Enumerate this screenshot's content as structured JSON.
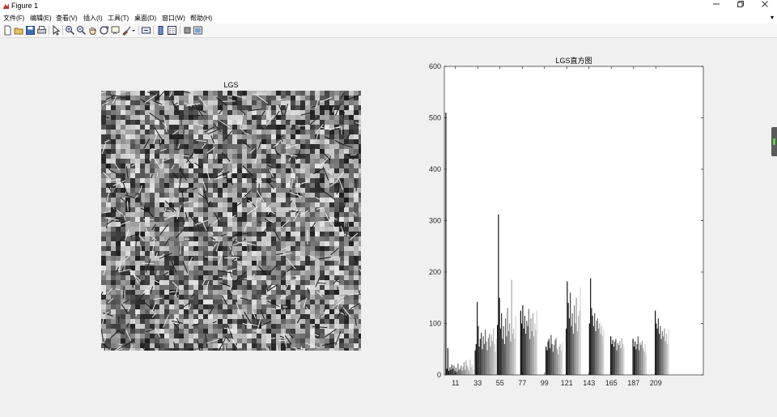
{
  "window": {
    "title": "Figure 1",
    "minimize_icon": "minimize-icon",
    "restore_icon": "restore-icon",
    "close_icon": "close-icon"
  },
  "menu": {
    "items": [
      "文件(F)",
      "编辑(E)",
      "查看(V)",
      "插入(I)",
      "工具(T)",
      "桌面(D)",
      "窗口(W)",
      "帮助(H)"
    ],
    "overflow_glyph": "▾"
  },
  "toolbar": {
    "icons": [
      "new-figure-icon",
      "open-file-icon",
      "save-icon",
      "print-icon",
      "edit-plot-arrow-icon",
      "zoom-in-icon",
      "zoom-out-icon",
      "pan-hand-icon",
      "rotate-3d-icon",
      "data-cursor-icon",
      "brush-icon",
      "link-plot-icon",
      "insert-colorbar-icon",
      "insert-legend-icon",
      "hide-plot-tools-icon",
      "show-plot-tools-icon"
    ]
  },
  "image_axes": {
    "title": "LGS"
  },
  "chart_data": {
    "type": "bar",
    "title": "LGS直方图",
    "xlabel": "",
    "ylabel": "",
    "xlim": [
      0,
      256
    ],
    "ylim": [
      0,
      600
    ],
    "yticks": [
      0,
      100,
      200,
      300,
      400,
      500,
      600
    ],
    "xticks": [
      11,
      33,
      55,
      77,
      99,
      121,
      143,
      165,
      187,
      209
    ],
    "bar_color_scheme": "grayscale gradient within each cluster (dark to light)",
    "clusters": [
      {
        "start": 1,
        "values": [
          510,
          12,
          52,
          8,
          15,
          10,
          20,
          12,
          18,
          8,
          14,
          6,
          22,
          10,
          12,
          18,
          8,
          15,
          25,
          10,
          28,
          18,
          12,
          8,
          30,
          15,
          20,
          10
        ]
      },
      {
        "start": 30,
        "values": [
          48,
          60,
          142,
          95,
          55,
          70,
          82,
          50,
          75,
          60,
          88,
          65,
          48,
          72,
          80,
          55,
          78,
          66,
          90,
          60,
          45,
          70
        ]
      },
      {
        "start": 52,
        "values": [
          97,
          312,
          150,
          90,
          120,
          70,
          95,
          60,
          110,
          75,
          130,
          85,
          100,
          65,
          185,
          80,
          90,
          70,
          115
        ]
      },
      {
        "start": 75,
        "values": [
          125,
          100,
          135,
          90,
          115,
          80,
          105,
          95,
          128,
          70,
          110,
          85,
          120,
          75,
          100,
          88,
          125
        ]
      },
      {
        "start": 100,
        "values": [
          55,
          48,
          65,
          70,
          52,
          78,
          60,
          45,
          58,
          68,
          72,
          50,
          40,
          55,
          60,
          48,
          62
        ]
      },
      {
        "start": 120,
        "values": [
          90,
          182,
          140,
          110,
          160,
          95,
          120,
          80,
          135,
          100,
          150,
          85,
          115,
          125,
          170
        ]
      },
      {
        "start": 143,
        "values": [
          100,
          188,
          130,
          115,
          95,
          120,
          85,
          105,
          110,
          90,
          100,
          80,
          95,
          75,
          88
        ]
      },
      {
        "start": 164,
        "values": [
          75,
          60,
          68,
          55,
          65,
          70,
          48,
          62,
          58,
          66,
          52,
          72,
          60,
          55
        ]
      },
      {
        "start": 186,
        "values": [
          70,
          55,
          65,
          50,
          60,
          75,
          48,
          62,
          58,
          66,
          52,
          45,
          60,
          40
        ]
      },
      {
        "start": 208,
        "values": [
          125,
          100,
          90,
          110,
          80,
          95,
          70,
          85,
          75,
          90,
          65,
          80,
          60,
          88
        ]
      }
    ]
  }
}
